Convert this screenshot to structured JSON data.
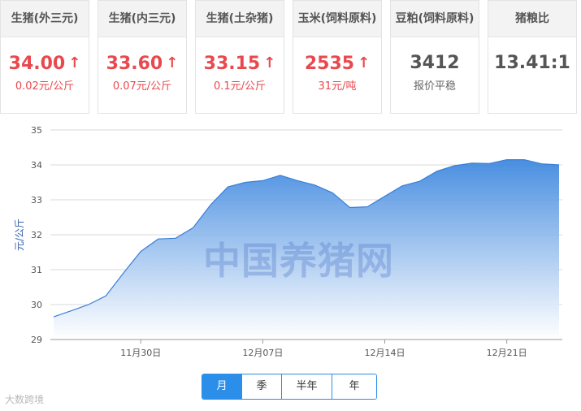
{
  "cards": [
    {
      "title": "生猪(外三元)",
      "value": "34.00",
      "arrow": "↑",
      "change": "0.02元/公斤",
      "trend": "up"
    },
    {
      "title": "生猪(内三元)",
      "value": "33.60",
      "arrow": "↑",
      "change": "0.07元/公斤",
      "trend": "up"
    },
    {
      "title": "生猪(土杂猪)",
      "value": "33.15",
      "arrow": "↑",
      "change": "0.1元/公斤",
      "trend": "up"
    },
    {
      "title": "玉米(饲料原料)",
      "value": "2535",
      "arrow": "↑",
      "change": "31元/吨",
      "trend": "up"
    },
    {
      "title": "豆粕(饲料原料)",
      "value": "3412",
      "arrow": "",
      "change": "报价平稳",
      "trend": "flat"
    },
    {
      "title": "猪粮比",
      "value": "13.41:1",
      "arrow": "",
      "change": "",
      "trend": "flat"
    }
  ],
  "watermark": "中国养猪网",
  "tabs": [
    {
      "label": "月"
    },
    {
      "label": "季"
    },
    {
      "label": "半年"
    },
    {
      "label": "年"
    }
  ],
  "logo_text": "大数跨境",
  "colors": {
    "accent": "#2b8ee8",
    "up": "#e8494e",
    "area_top": "#3f88df",
    "line": "#3a7fd8"
  },
  "chart_data": {
    "type": "area",
    "ylabel": "元/公斤",
    "ylim": [
      29,
      35
    ],
    "yticks": [
      29,
      30,
      31,
      32,
      33,
      34,
      35
    ],
    "xticks": [
      "11月30日",
      "12月07日",
      "12月14日",
      "12月21日"
    ],
    "grid": true,
    "x": [
      "11/25",
      "11/26",
      "11/27",
      "11/28",
      "11/29",
      "11/30",
      "12/01",
      "12/02",
      "12/03",
      "12/04",
      "12/05",
      "12/06",
      "12/07",
      "12/08",
      "12/09",
      "12/10",
      "12/11",
      "12/12",
      "12/13",
      "12/14",
      "12/15",
      "12/16",
      "12/17",
      "12/18",
      "12/19",
      "12/20",
      "12/21",
      "12/22",
      "12/23",
      "12/24"
    ],
    "values": [
      29.65,
      29.82,
      30.0,
      30.25,
      30.9,
      31.52,
      31.88,
      31.9,
      32.2,
      32.85,
      33.37,
      33.5,
      33.55,
      33.7,
      33.55,
      33.42,
      33.2,
      32.78,
      32.8,
      33.1,
      33.4,
      33.53,
      33.82,
      33.98,
      34.05,
      34.04,
      34.15,
      34.15,
      34.03,
      34.0
    ]
  }
}
